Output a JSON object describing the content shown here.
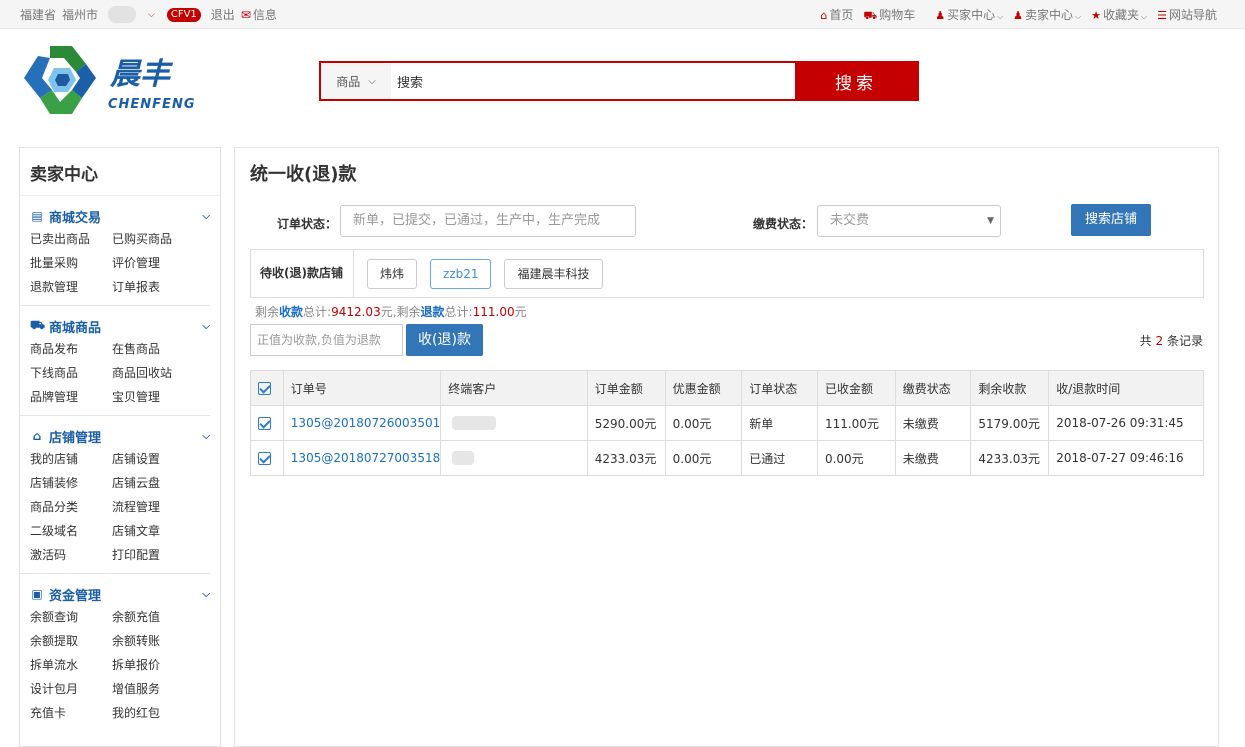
{
  "topbar": {
    "province": "福建省",
    "city": "福州市",
    "badge": "CFV1",
    "logout": "退出",
    "mail_label": "信息",
    "links": [
      {
        "icon": "home-icon",
        "glyph": "⌂",
        "label": "首页",
        "dropdown": false
      },
      {
        "icon": "cart-icon",
        "glyph": "⛟",
        "label": "购物车",
        "dropdown": false
      },
      {
        "icon": "user-icon",
        "glyph": "♟",
        "label": "买家中心",
        "dropdown": true
      },
      {
        "icon": "user-icon",
        "glyph": "♟",
        "label": "卖家中心",
        "dropdown": true
      },
      {
        "icon": "star-icon",
        "glyph": "★",
        "label": "收藏夹",
        "dropdown": true
      },
      {
        "icon": "list-icon",
        "glyph": "☰",
        "label": "网站导航",
        "dropdown": true
      }
    ]
  },
  "logo": {
    "cn": "晨丰",
    "en": "CHENFENG"
  },
  "search": {
    "category": "商品",
    "value": "搜索",
    "button": "搜索"
  },
  "sidebar": {
    "title": "卖家中心",
    "sections": [
      {
        "icon": "card-icon",
        "glyph": "▤",
        "title": "商城交易",
        "items": [
          "已卖出商品",
          "已购买商品",
          "批量采购",
          "评价管理",
          "退款管理",
          "订单报表"
        ]
      },
      {
        "icon": "truck-icon",
        "glyph": "⛟",
        "title": "商城商品",
        "items": [
          "商品发布",
          "在售商品",
          "下线商品",
          "商品回收站",
          "品牌管理",
          "宝贝管理"
        ]
      },
      {
        "icon": "home-icon",
        "glyph": "⌂",
        "title": "店铺管理",
        "items": [
          "我的店铺",
          "店铺设置",
          "店铺装修",
          "店铺云盘",
          "商品分类",
          "流程管理",
          "二级域名",
          "店铺文章",
          "激活码",
          "打印配置"
        ]
      },
      {
        "icon": "money-icon",
        "glyph": "▣",
        "title": "资金管理",
        "items": [
          "余额查询",
          "余额充值",
          "余额提取",
          "余额转账",
          "拆单流水",
          "拆单报价",
          "设计包月",
          "增值服务",
          "充值卡",
          "我的红包"
        ]
      }
    ]
  },
  "main": {
    "title": "统一收(退)款",
    "order_status_label": "订单状态：",
    "order_status_placeholder": "新单，已提交，已通过，生产中，生产完成",
    "fee_status_label": "缴费状态：",
    "fee_status_value": "未交费",
    "search_shop_button": "搜索店铺",
    "pending_shops_label": "待收(退)款店铺",
    "shops": [
      {
        "name": "炜炜",
        "active": false
      },
      {
        "name": "zzb21",
        "active": true
      },
      {
        "name": "福建晨丰科技",
        "active": false
      }
    ],
    "summary": {
      "prefix1": "剩余",
      "collect": "收款",
      "total1": "总计:",
      "collect_amount": "9412.03",
      "unit1": "元,剩余",
      "refund": "退款",
      "total2": "总计:",
      "refund_amount": "111.00",
      "unit2": "元"
    },
    "amount_placeholder": "正值为收款,负值为退款",
    "collect_button": "收(退)款",
    "total_records": {
      "prefix": "共",
      "count": "2",
      "suffix": "条记录"
    },
    "table": {
      "headers": [
        "订单号",
        "终端客户",
        "订单金额",
        "优惠金额",
        "订单状态",
        "已收金额",
        "缴费状态",
        "剩余收款",
        "收/退款时间"
      ],
      "rows": [
        [
          "1305@20180726003501",
          "",
          "5290.00元",
          "0.00元",
          "新单",
          "111.00元",
          "未缴费",
          "5179.00元",
          "2018-07-26 09:31:45"
        ],
        [
          "1305@20180727003518",
          "",
          "4233.03元",
          "0.00元",
          "已通过",
          "0.00元",
          "未缴费",
          "4233.03元",
          "2018-07-27 09:46:16"
        ]
      ]
    }
  },
  "colors": {
    "brand_red": "#c40000",
    "accent_blue": "#3276b8",
    "link_blue": "#1a6fc4"
  }
}
